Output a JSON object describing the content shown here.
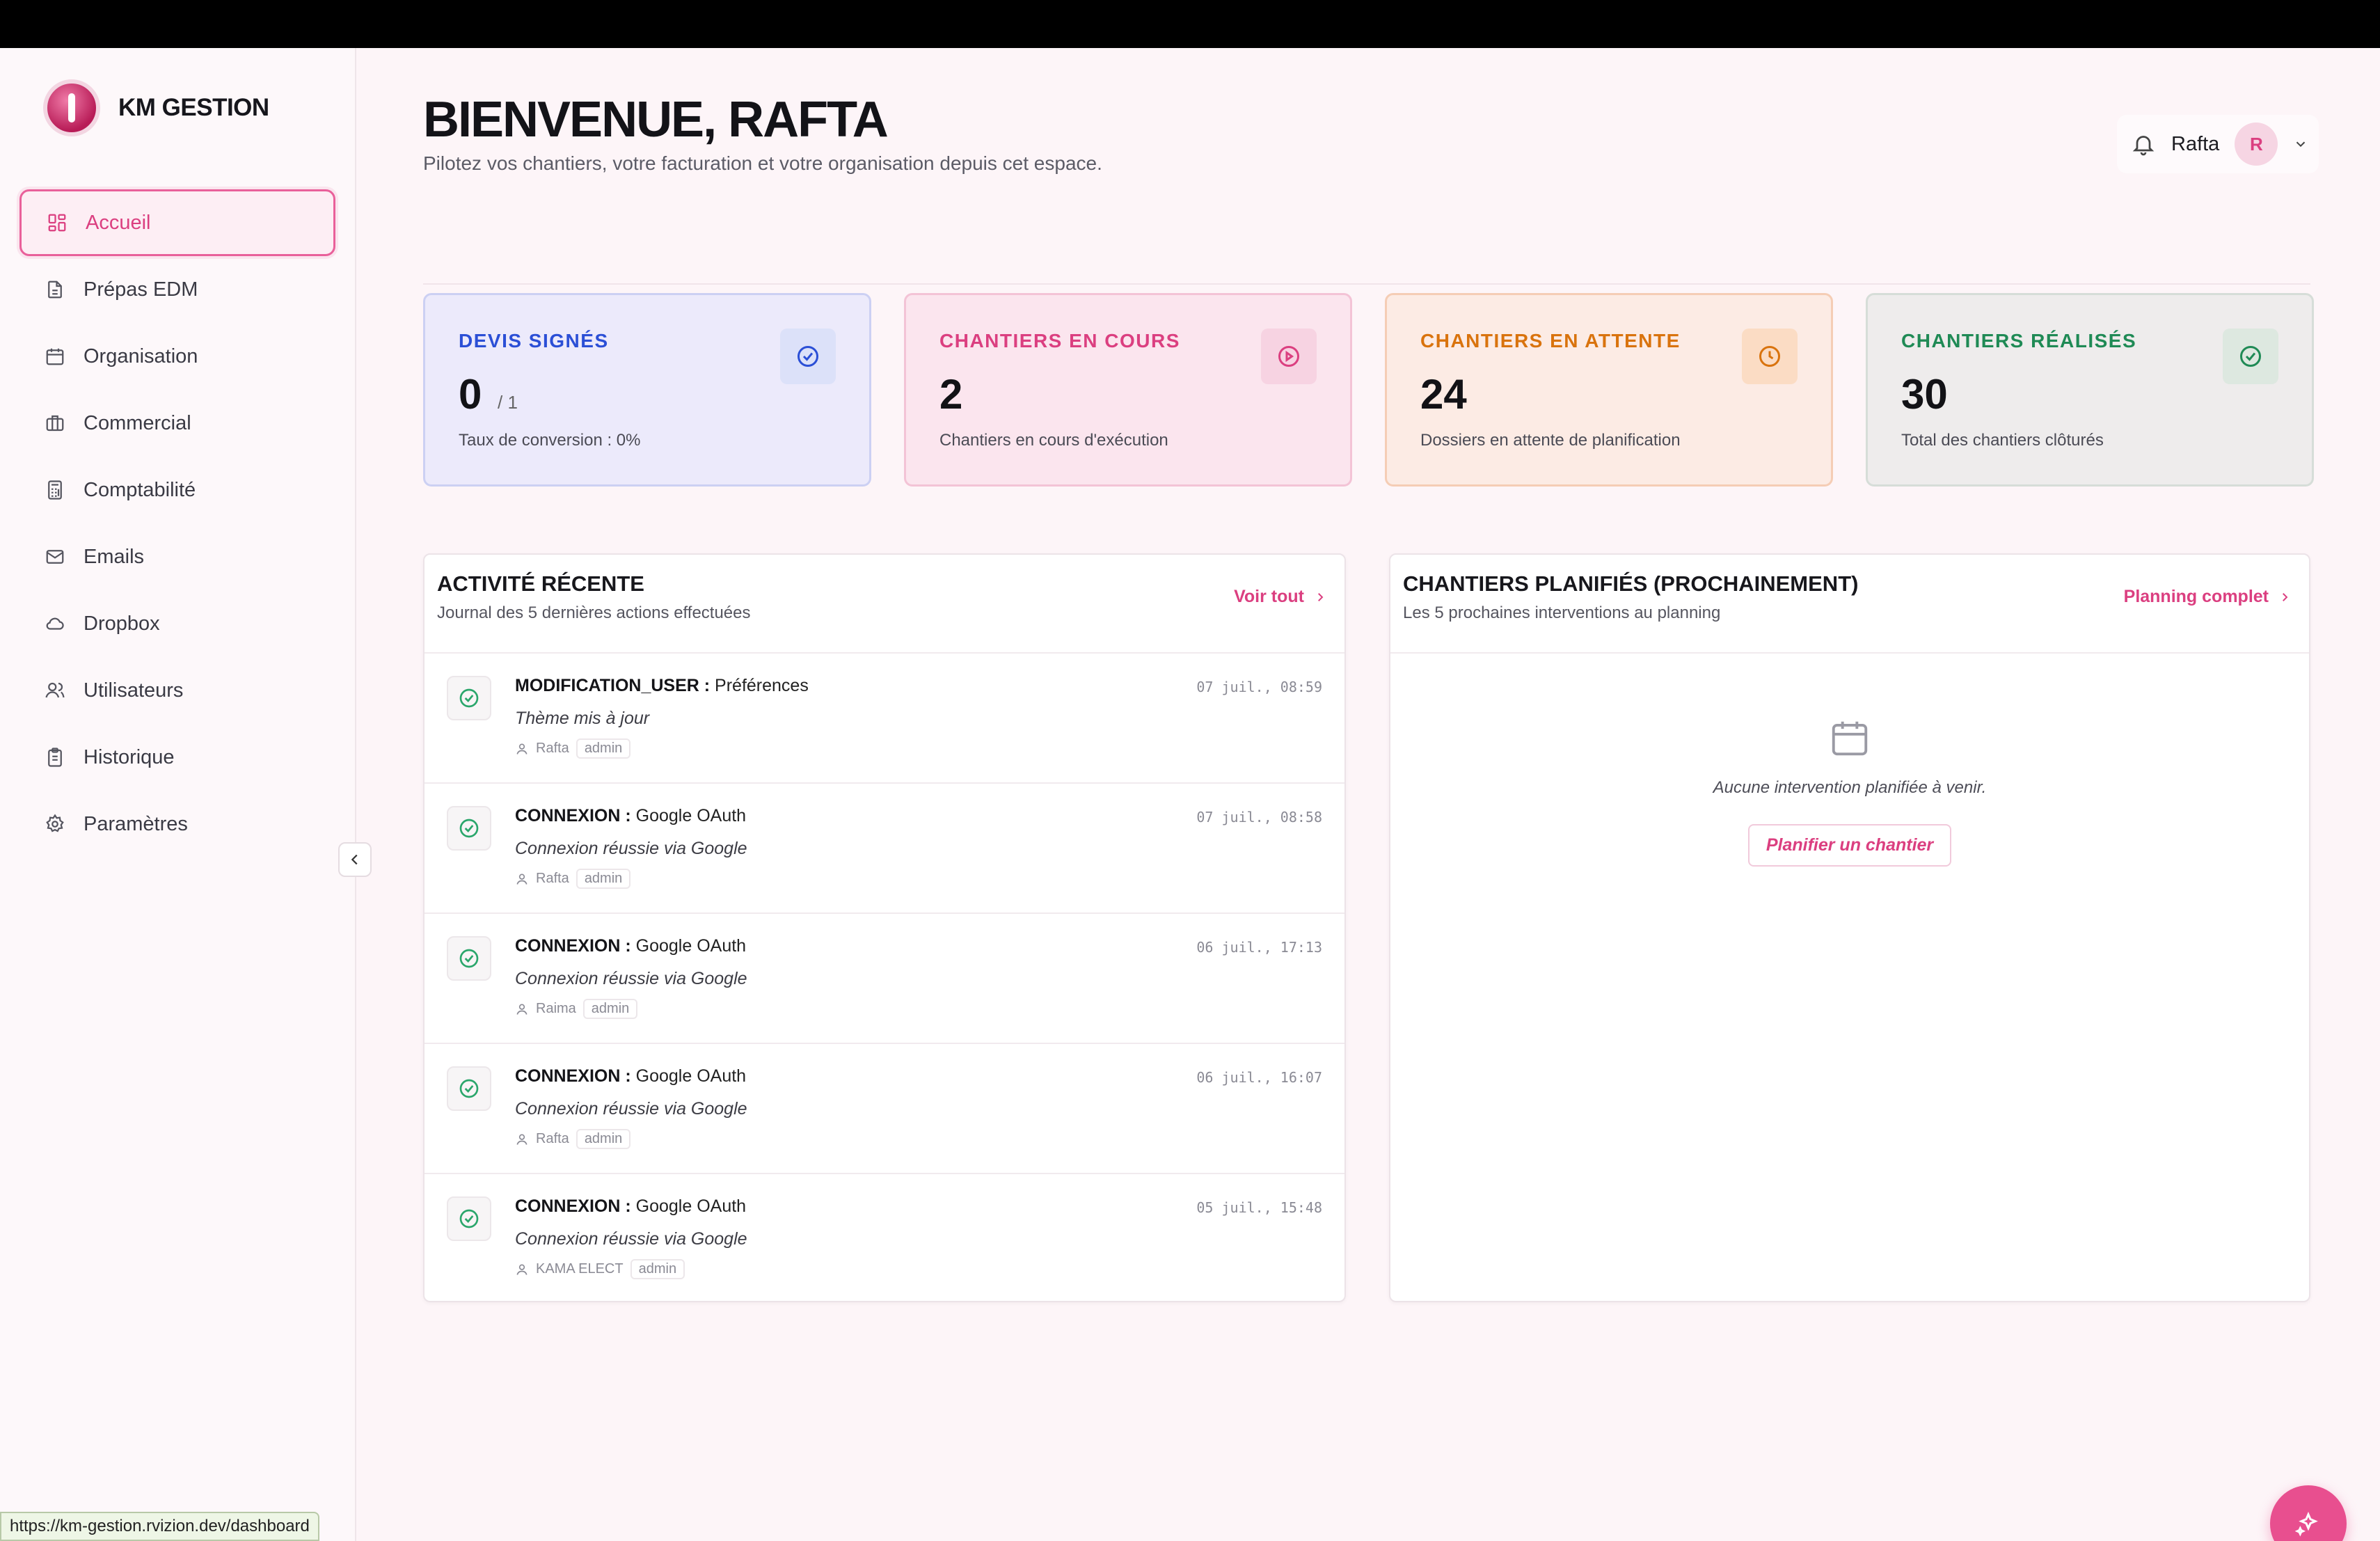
{
  "browser": {
    "status_url": "https://km-gestion.rvizion.dev/dashboard"
  },
  "brand": {
    "name": "KM GESTION"
  },
  "sidebar": {
    "items": [
      {
        "label": "Accueil",
        "icon": "dashboard-icon",
        "active": true
      },
      {
        "label": "Prépas EDM",
        "icon": "document-icon"
      },
      {
        "label": "Organisation",
        "icon": "calendar-icon"
      },
      {
        "label": "Commercial",
        "icon": "briefcase-icon"
      },
      {
        "label": "Comptabilité",
        "icon": "calculator-icon"
      },
      {
        "label": "Emails",
        "icon": "mail-icon"
      },
      {
        "label": "Dropbox",
        "icon": "cloud-icon"
      },
      {
        "label": "Utilisateurs",
        "icon": "users-icon"
      },
      {
        "label": "Historique",
        "icon": "clipboard-icon"
      },
      {
        "label": "Paramètres",
        "icon": "gear-icon"
      }
    ]
  },
  "header": {
    "title": "BIENVENUE, RAFTA",
    "subtitle": "Pilotez vos chantiers, votre facturation et votre organisation depuis cet espace.",
    "user": {
      "name": "Rafta",
      "initial": "R"
    }
  },
  "stats": [
    {
      "label": "DEVIS SIGNÉS",
      "value": "0",
      "suffix": "/ 1",
      "desc": "Taux de conversion : 0%",
      "color": "#2b4fd6",
      "icon": "check-circle-icon"
    },
    {
      "label": "CHANTIERS EN COURS",
      "value": "2",
      "suffix": "",
      "desc": "Chantiers en cours d'exécution",
      "color": "#db3f80",
      "icon": "play-circle-icon"
    },
    {
      "label": "CHANTIERS EN ATTENTE",
      "value": "24",
      "suffix": "",
      "desc": "Dossiers en attente de planification",
      "color": "#d9730d",
      "icon": "clock-icon"
    },
    {
      "label": "CHANTIERS RÉALISÉS",
      "value": "30",
      "suffix": "",
      "desc": "Total des chantiers clôturés",
      "color": "#1f8a55",
      "icon": "check-circle-icon"
    }
  ],
  "activity": {
    "title": "ACTIVITÉ RÉCENTE",
    "subtitle": "Journal des 5 dernières actions effectuées",
    "link": "Voir tout",
    "items": [
      {
        "action": "MODIFICATION_USER :",
        "target": "Préférences",
        "note": "Thème mis à jour",
        "user": "Rafta",
        "role": "admin",
        "time": "07 juil., 08:59"
      },
      {
        "action": "CONNEXION :",
        "target": "Google OAuth",
        "note": "Connexion réussie via Google",
        "user": "Rafta",
        "role": "admin",
        "time": "07 juil., 08:58"
      },
      {
        "action": "CONNEXION :",
        "target": "Google OAuth",
        "note": "Connexion réussie via Google",
        "user": "Raima",
        "role": "admin",
        "time": "06 juil., 17:13"
      },
      {
        "action": "CONNEXION :",
        "target": "Google OAuth",
        "note": "Connexion réussie via Google",
        "user": "Rafta",
        "role": "admin",
        "time": "06 juil., 16:07"
      },
      {
        "action": "CONNEXION :",
        "target": "Google OAuth",
        "note": "Connexion réussie via Google",
        "user": "KAMA ELECT",
        "role": "admin",
        "time": "05 juil., 15:48"
      }
    ]
  },
  "planned": {
    "title": "CHANTIERS PLANIFIÉS (PROCHAINEMENT)",
    "subtitle": "Les 5 prochaines interventions au planning",
    "link": "Planning complet",
    "empty_text": "Aucune intervention planifiée à venir.",
    "button": "Planifier un chantier"
  }
}
